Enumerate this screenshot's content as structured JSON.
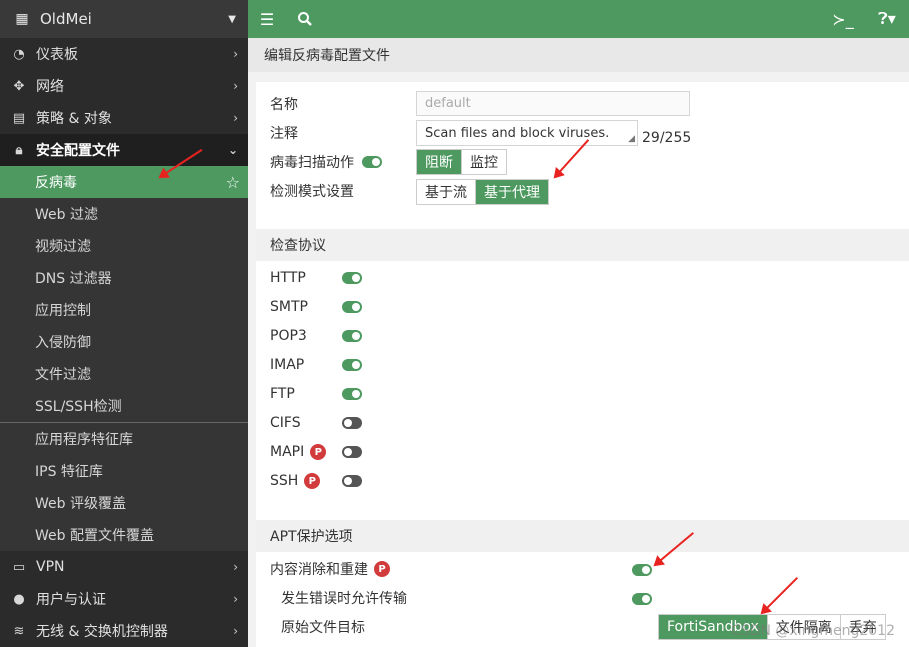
{
  "sidebar": {
    "brand": "OldMei",
    "items": [
      {
        "label": "仪表板",
        "icon": "dashboard-icon"
      },
      {
        "label": "网络",
        "icon": "network-icon"
      },
      {
        "label": "策略 & 对象",
        "icon": "policy-icon"
      },
      {
        "label": "安全配置文件",
        "icon": "lock-icon"
      }
    ],
    "sub_items": [
      "反病毒",
      "Web 过滤",
      "视频过滤",
      "DNS 过滤器",
      "应用控制",
      "入侵防御",
      "文件过滤",
      "SSL/SSH检测"
    ],
    "sub_items2": [
      "应用程序特征库",
      "IPS 特征库",
      "Web 评级覆盖",
      "Web 配置文件覆盖"
    ],
    "bottom_items": [
      {
        "label": "VPN",
        "icon": "laptop-icon"
      },
      {
        "label": "用户与认证",
        "icon": "user-icon"
      },
      {
        "label": "无线 & 交换机控制器",
        "icon": "wifi-icon"
      }
    ]
  },
  "page": {
    "title": "编辑反病毒配置文件"
  },
  "form": {
    "name_label": "名称",
    "name_placeholder": "default",
    "comment_label": "注释",
    "comment_value": "Scan files and block viruses.",
    "comment_counter": "29/255",
    "scan_action_label": "病毒扫描动作",
    "scan_action_options": [
      "阻断",
      "监控"
    ],
    "scan_action_selected": "阻断",
    "inspection_mode_label": "检测模式设置",
    "inspection_mode_options": [
      "基于流",
      "基于代理"
    ],
    "inspection_mode_selected": "基于代理"
  },
  "protocols": {
    "header": "检查协议",
    "items": [
      {
        "name": "HTTP",
        "on": true,
        "badge": ""
      },
      {
        "name": "SMTP",
        "on": true,
        "badge": ""
      },
      {
        "name": "POP3",
        "on": true,
        "badge": ""
      },
      {
        "name": "IMAP",
        "on": true,
        "badge": ""
      },
      {
        "name": "FTP",
        "on": true,
        "badge": ""
      },
      {
        "name": "CIFS",
        "on": false,
        "badge": ""
      },
      {
        "name": "MAPI",
        "on": false,
        "badge": "P"
      },
      {
        "name": "SSH",
        "on": false,
        "badge": "P"
      }
    ]
  },
  "apt": {
    "header": "APT保护选项",
    "cdr_label": "内容消除和重建",
    "cdr_badge": "P",
    "cdr_on": true,
    "allow_label": "发生错误时允许传输",
    "allow_on": true,
    "dest_label": "原始文件目标",
    "dest_options": [
      "FortiSandbox",
      "文件隔离",
      "丢弃"
    ],
    "dest_selected": "FortiSandbox"
  },
  "watermark": "CSDN @xingmeng2012",
  "colors": {
    "accent": "#4d9960",
    "sidebar_bg": "#2b2b2b",
    "arrow": "#e8231f"
  }
}
